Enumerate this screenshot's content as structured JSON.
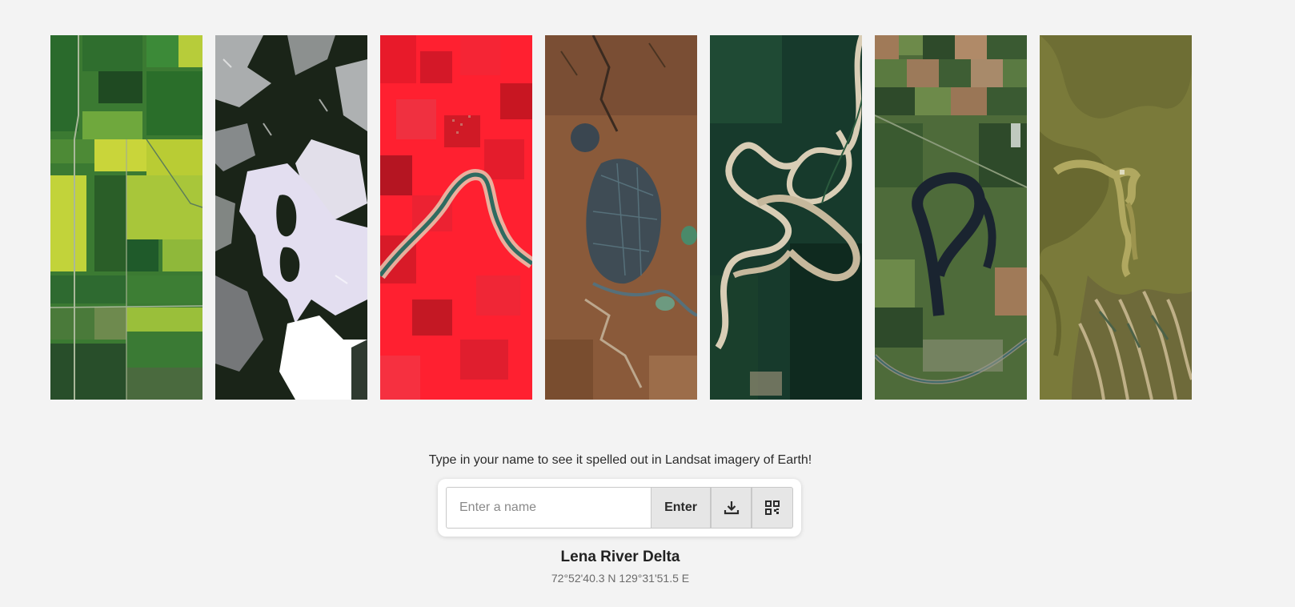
{
  "tiles": [
    {
      "name": "tile-farmland-green",
      "colors": [
        "#3b7a32",
        "#c9d53a",
        "#2a5e28",
        "#6fa83d",
        "#1f4a22"
      ]
    },
    {
      "name": "tile-ice-dark",
      "colors": [
        "#ffffff",
        "#111a12",
        "#e8e4f2",
        "#2f3a30",
        "#cfcad9"
      ]
    },
    {
      "name": "tile-red-infrared",
      "colors": [
        "#ff2030",
        "#d81a28",
        "#b51522",
        "#2f6b60",
        "#e8c9b0"
      ]
    },
    {
      "name": "tile-brown-lake",
      "colors": [
        "#8a5a3a",
        "#6e4428",
        "#3a4650",
        "#56707a",
        "#a87a55"
      ]
    },
    {
      "name": "tile-forest-river",
      "colors": [
        "#173a2c",
        "#0f2a1f",
        "#d9cdb5",
        "#2b5a3e",
        "#c6b89c"
      ]
    },
    {
      "name": "tile-fields-oxbow",
      "colors": [
        "#4e6b3a",
        "#2e4a2a",
        "#1a2430",
        "#a07a58",
        "#6d8a4a"
      ]
    },
    {
      "name": "tile-delta-olive",
      "colors": [
        "#7a7a3a",
        "#5e5e2a",
        "#b0a860",
        "#c8b890",
        "#4c6248"
      ]
    }
  ],
  "prompt": "Type in your name to see it spelled out in Landsat imagery of Earth!",
  "input": {
    "placeholder": "Enter a name",
    "value": ""
  },
  "buttons": {
    "enter": "Enter",
    "download_icon": "download-icon",
    "qr_icon": "qr-code-icon"
  },
  "location": {
    "name": "Lena River Delta",
    "coords": "72°52'40.3 N 129°31'51.5 E"
  }
}
